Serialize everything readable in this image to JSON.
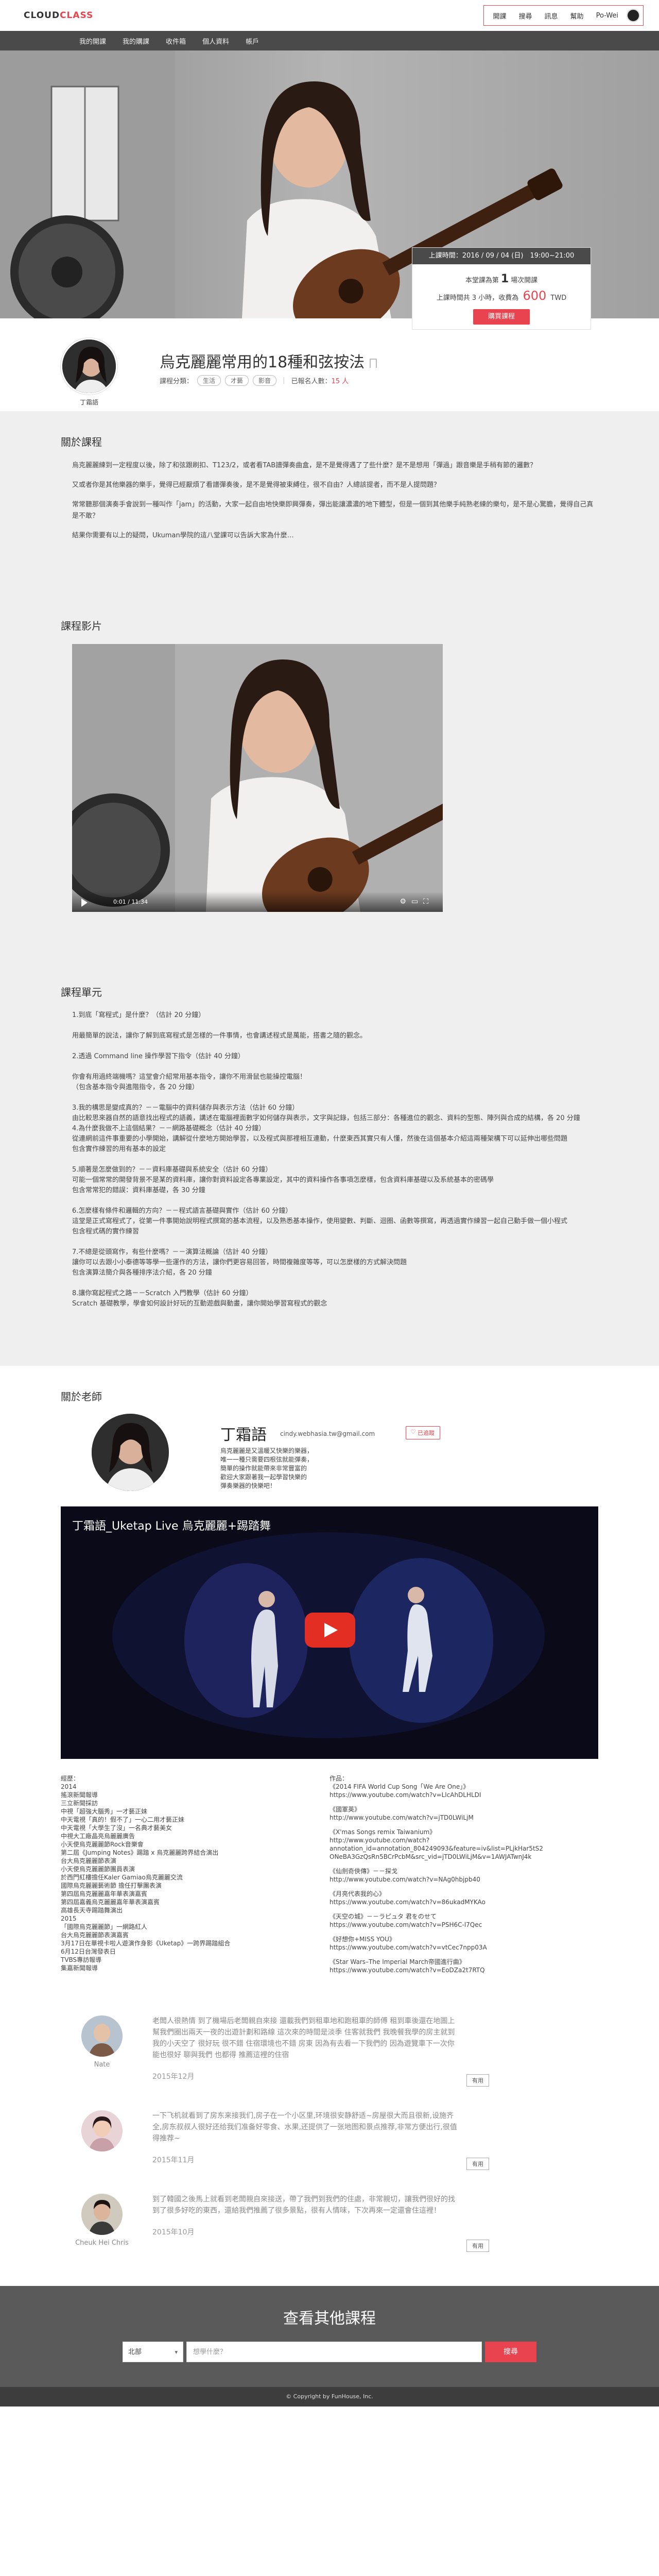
{
  "header": {
    "logo_a": "CLOUD",
    "logo_b": "CLASS",
    "nav": [
      "開課",
      "搜尋",
      "訊息",
      "幫助"
    ],
    "user": "Po-Wei"
  },
  "subnav": [
    "我的開課",
    "我的購課",
    "收件箱",
    "個人資料",
    "帳戶"
  ],
  "booking": {
    "header": "上課時間：2016 / 09 / 04 (日)　19:00~21:00",
    "seats_prefix": "本堂課為第",
    "seats_value": "1",
    "seats_suffix": "場次開課",
    "duration_text": "上課時間共 3 小時，收費為",
    "price": "600",
    "currency": "TWD",
    "button": "購買課程"
  },
  "course": {
    "teacher": "丁霜語",
    "title": "烏克麗麗常用的18種和弦按法",
    "category_label": "課程分類：",
    "tags": [
      "生活",
      "才藝",
      "影音"
    ],
    "enrolled_label": "已報名人數：",
    "enrolled_value": "15 人"
  },
  "about": {
    "title": "關於課程",
    "paragraphs": [
      "烏克麗麗練到一定程度以後，除了和弦跟刷扣、T123/2，或者看TAB譜彈奏曲盒，是不是覺得遇了了些什麼？是不是想用「彈過」跟音樂是手稍有節的邏數？",
      "又或者你是其他樂器的樂手，覺得已經厭煩了看譜彈奏後，是不是覺得被束縛住，很不自由？人總該提者，而不是人提問題？",
      "常常聽那個演奏手會說到一種叫作「jam」的活動，大家一起自由地快樂即興彈奏，彈出能讓濃濃的地下體型，但是一個到其他樂手純熟老練的樂句，是不是心驚膽，覺得自己真是不敢？",
      "結果你需要有以上的疑問，Ukuman學院的這八堂課可以告訴大家為什麼…"
    ]
  },
  "video": {
    "title": "課程影片",
    "time": "0:01 / 11:34"
  },
  "units": {
    "title": "課程單元",
    "items": [
      [
        "1.到底「寫程式」是什麼？（估計 20 分鐘）",
        "用最簡單的說法，讓你了解到底寫程式是怎樣的一件事情，也會講述程式是萬能，搭書之隨的觀念。"
      ],
      [
        "2.透過 Command line 操作學習下指令（估計 40 分鐘）",
        "",
        "你會有用過終端機嗎？這堂會介紹常用基本指令，讓你不用滑鼠也能操控電腦！",
        "（包含基本指令與進階指令，各 20 分鐘）"
      ],
      [
        "3.我的構思是變成真的？－－電腦中的資料儲存與表示方法（估計 60 分鐘）",
        "由比較思來器自然的語意找出程式的語義，講述在電腦裡面數字如何儲存與表示，文字與記錄，包括三部分：各種進位的觀念、資料的型態、陣列與合成的結構，各 20 分鐘",
        "4.為什麼我做不上這個結果？－－網路基礎概念（估計 40 分鐘）",
        "從連網前這件事重要的小學開始，講解從什麼地方開始學習，以及程式與那裡相互連動，什麼東西其實只有人懂，然後在這個基本介紹這兩種架構下可以延伸出哪些問題",
        "包含實作練習的用有基本的設定"
      ],
      [
        "5.順著是怎麼做到的？－－資料庫基礎與系統安全（估計 60 分鐘）",
        "可能一個常常的開發背景不是某的資料庫，讓你對資料設定各專業設定，其中的資料操作各事項怎麼樣，包含資料庫基礎以及系統基本的密碼學",
        "包含常常犯的錯誤：資料庫基礎，各 30 分鐘"
      ],
      [
        "6.怎麼樣有條件和邏輯的方向？－－程式語言基礎與實作（估計 60 分鐘）",
        "這堂是正式寫程式了，從第一件事開始說明程式撰寫的基本流程，以及熟悉基本操作，使用變數、判斷、迴圈、函數等撰寫，再透過實作練習一起自己動手做一個小程式",
        "包含程式碼的實作練習"
      ],
      [
        "7.不總是從頭寫作，有些什麼嗎？－－演算法概論（估計 40 分鐘）",
        "讓你可以去跟小小泰德等等學一些運作的方法，讓你們更容易回答，時間複雜度等等，可以怎麼樣的方式解決問題",
        "包含演算法簡介與各種排序法介紹，各 20 分鐘"
      ],
      [
        "8.讓你寫起程式之路－－Scratch 入門教學（估計 60 分鐘）",
        "Scratch 基礎教學，學會如何設計好玩的互動遊戲與動畫，讓你開始學習寫程式的觀念"
      ]
    ]
  },
  "teacher": {
    "section_title": "關於老師",
    "name": "丁霜語",
    "email": "cindy.webhasia.tw@gmail.com",
    "follow": "已追蹤",
    "bio": [
      "烏克麗麗是又溫暖又快樂的樂器，",
      "唯一一種只需要四根弦就能彈奏，",
      "簡單的操作就能帶來非常豐富的",
      "歡迎大家跟著我一起學習快樂的",
      "彈奏樂器的快樂吧！"
    ],
    "video_title": "丁霜語_Uketap Live 烏克麗麗+踢踏舞"
  },
  "experience": {
    "left": [
      "經歷：",
      "2014",
      "搖滾新聞報導",
      "三立新聞採訪",
      "中視「超強大腦秀」一才藝正妹",
      "中天電視「真的！假不了」一心二用才藝正妹",
      "中天電視「大學生了沒」一名典才藝美女",
      "中視大工廠晶亮烏麗麗廣告",
      "小天使烏克麗麗節Rock音樂會",
      "第二屆《Jumping Notes》踢踏 x 烏克麗麗跨界結合演出",
      "台大烏克麗麗節表演",
      "小天使烏克麗麗節團員表演",
      "於西門紅樓擔任Kaler Gamiao烏克麗麗交流",
      "國際烏克麗麗藝術節 擔任打擊團表演",
      "第四屆烏克麗麗嘉年華表演嘉賓",
      "第四屆嘉義烏克麗麗嘉年華表演嘉賓",
      "高雄長天寺踢踏舞演出",
      "2015",
      "「國際烏克麗麗節」一網路紅人",
      "台大烏克麗麗節表演嘉賓",
      "3月17日在華視卡啦人遊演作身影《Uketap》一跨界踢踏組合",
      "6月12日台灣發表日",
      "TVBS專訪報導",
      "集嘉新聞報導"
    ],
    "right": [
      "作品：",
      "《2014 FIFA World Cup Song「We Are One」》",
      "https://www.youtube.com/watch?v=LlcAhDLHLDI",
      "《國軍英》",
      "http://www.youtube.com/watch?v=jTD0LWiLjM",
      "《X'mas Songs remix Taiwanium》",
      "http://www.youtube.com/watch?",
      "annotation_id=annotation_804249093&feature=iv&list=PLjkHar5tS2",
      "ONeBA3GzQsRn5BCrPcbM&src_vid=jTD0LWiLjM&v=1AWJATwnJ4k",
      "《仙劍奇俠傳》－－探戈",
      "http://www.youtube.com/watch?v=NAg0hbjpb40",
      "《月亮代表我的心》",
      "https://www.youtube.com/watch?v=86ukadMYKAo",
      "《天空の城》－－ラピュタ 君をのせて",
      "https://www.youtube.com/watch?v=PSH6C-l7Qec",
      "《好想你+MISS YOU》",
      "https://www.youtube.com/watch?v=vtCec7npp03A",
      "《Star Wars–The Imperial March帝國進行曲》",
      "https://www.youtube.com/watch?v=EoDZa2t7RTQ"
    ]
  },
  "reviews": [
    {
      "name": "Nate",
      "text": "老闆人很熱情 到了機場后老闆親自來接 還載我們到租車地和跑租車的師傅 租到車後還在地圖上幫我們圈出兩天一夜的出遊計劃和路線 這次來的時間是淡季 住客就我們 我晚餐我學的房主就到我的小天空了 很好玩 很不錯 住宿環境也不錯 房東 因為有去看一下我們的 因為遊覽車下一次你能也很好 聊與我們 也都得 推薦這裡的住宿",
      "date": "2015年12月",
      "button": "有用"
    },
    {
      "name": "",
      "text": "一下飞机就看到了房东来接我们,房子在一个小区里,环境很安静舒适~房屋很大而且很新,设施齐全,房东叔叔人很好还给我们准备好零食、水果,还提供了一张地图和景点推荐,非常方便出行,很值得推荐~",
      "date": "2015年11月",
      "button": "有用"
    },
    {
      "name": "Cheuk Hei Chris",
      "text": "到了韓國之後馬上就看到老闆親自來接送，帶了我們到我們的住處，非常親切，讓我們很好的找到了很多好吃的東西，還給我們推薦了很多景點，很有人情味，下次再來一定還會住這裡！",
      "date": "2015年10月",
      "button": "有用"
    }
  ],
  "more": {
    "title": "查看其他課程",
    "select": "北部",
    "placeholder": "想學什麼？",
    "search": "搜尋"
  },
  "footer": "© Copyright by FunHouse, Inc."
}
